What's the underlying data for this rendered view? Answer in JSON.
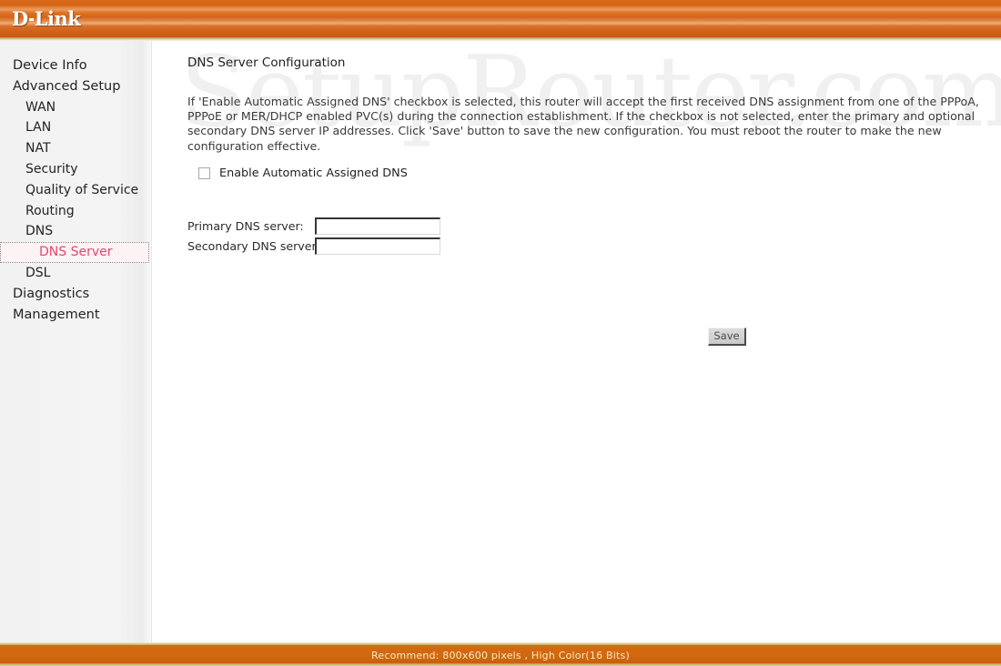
{
  "header": {
    "brand_prefix": "D",
    "brand_suffix": "Link",
    "background_color": "#d4651a"
  },
  "watermark": {
    "text": "SetupRouter.com",
    "color": "#f0f0f0"
  },
  "sidebar": {
    "items": [
      {
        "label": "Device Info",
        "level": 0,
        "selected": false
      },
      {
        "label": "Advanced Setup",
        "level": 0,
        "selected": false
      },
      {
        "label": "WAN",
        "level": 1,
        "selected": false
      },
      {
        "label": "LAN",
        "level": 1,
        "selected": false
      },
      {
        "label": "NAT",
        "level": 1,
        "selected": false
      },
      {
        "label": "Security",
        "level": 1,
        "selected": false
      },
      {
        "label": "Quality of Service",
        "level": 1,
        "selected": false
      },
      {
        "label": "Routing",
        "level": 1,
        "selected": false
      },
      {
        "label": "DNS",
        "level": 1,
        "selected": false
      },
      {
        "label": "DNS Server",
        "level": 2,
        "selected": true
      },
      {
        "label": "DSL",
        "level": 1,
        "selected": false
      },
      {
        "label": "Diagnostics",
        "level": 0,
        "selected": false
      },
      {
        "label": "Management",
        "level": 0,
        "selected": false
      }
    ],
    "selected_color": "#e8456c"
  },
  "main": {
    "page_title": "DNS Server Configuration",
    "description": "If 'Enable Automatic Assigned DNS' checkbox is selected, this router will accept the first received DNS assignment from one of the PPPoA, PPPoE or MER/DHCP enabled PVC(s) during the connection establishment. If the checkbox is not selected, enter the primary and optional secondary DNS server IP addresses. Click 'Save' button to save the new configuration. You must reboot the router to make the new configuration effective.",
    "auto_dns": {
      "label": "Enable Automatic Assigned DNS",
      "checked": false
    },
    "fields": [
      {
        "label": "Primary DNS server:",
        "value": "",
        "placeholder": ""
      },
      {
        "label": "Secondary DNS server:",
        "value": "",
        "placeholder": ""
      }
    ],
    "save_label": "Save"
  },
  "footer": {
    "text": "Recommend: 800x600 pixels , High Color(16 Bits)",
    "background_color": "#d2680f"
  }
}
